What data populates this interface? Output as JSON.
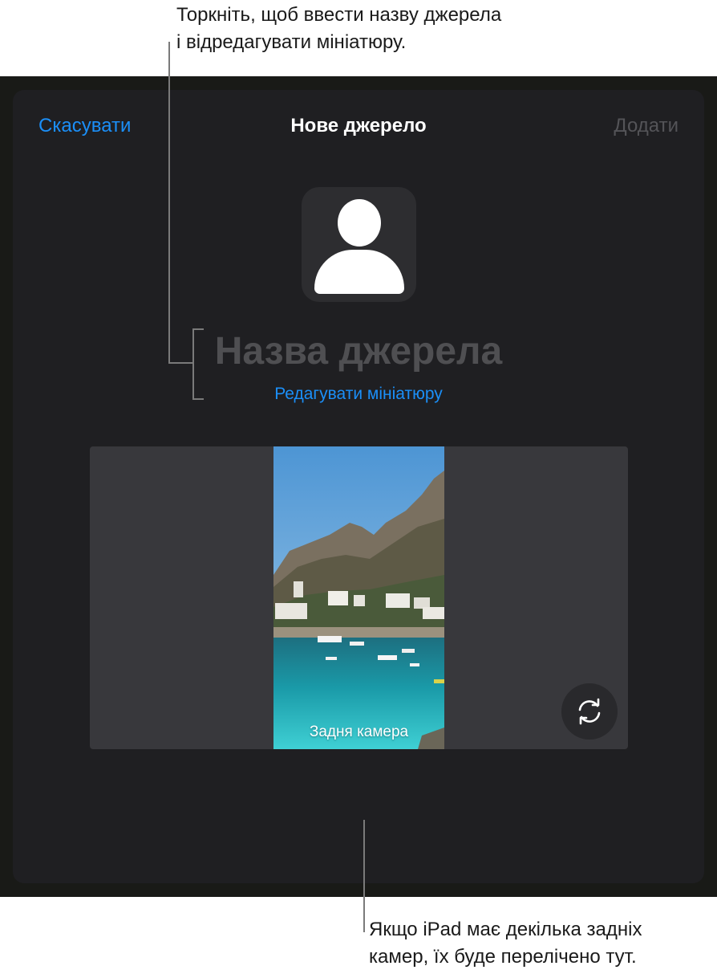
{
  "callouts": {
    "top": [
      "Торкніть, щоб ввести назву джерела",
      "і відредагувати мініатюру."
    ],
    "bottom": [
      "Якщо iPad має декілька задніх",
      "камер, їх буде перелічено тут."
    ]
  },
  "nav": {
    "cancel_label": "Скасувати",
    "title": "Нове джерело",
    "add_label": "Додати"
  },
  "source": {
    "name_placeholder": "Назва джерела",
    "edit_thumbnail_label": "Редагувати мініатюру"
  },
  "camera": {
    "label": "Задня камера"
  },
  "icons": {
    "avatar": "person-silhouette-icon",
    "switch_camera": "rotate-arrows-icon"
  },
  "colors": {
    "accent": "#1b8ff8",
    "disabled": "#545458",
    "sheet_background": "#1f1f22",
    "placeholder": "#4f4f52"
  }
}
